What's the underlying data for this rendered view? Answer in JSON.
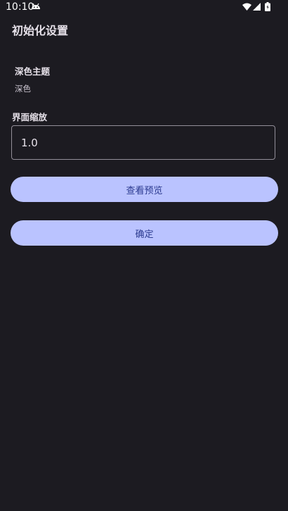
{
  "status_bar": {
    "time": "10:10",
    "icons": [
      "android-debug-icon",
      "wifi-icon",
      "signal-icon",
      "battery-icon"
    ]
  },
  "page": {
    "title": "初始化设置"
  },
  "theme": {
    "heading": "深色主题",
    "value": "深色"
  },
  "scale": {
    "label": "界面缩放",
    "value": "1.0"
  },
  "buttons": {
    "preview_label": "查看预览",
    "confirm_label": "确定"
  },
  "colors": {
    "background": "#1c1b21",
    "button_fill": "#bac3ff",
    "button_text": "#2b3a8f",
    "field_border": "#938f99"
  }
}
